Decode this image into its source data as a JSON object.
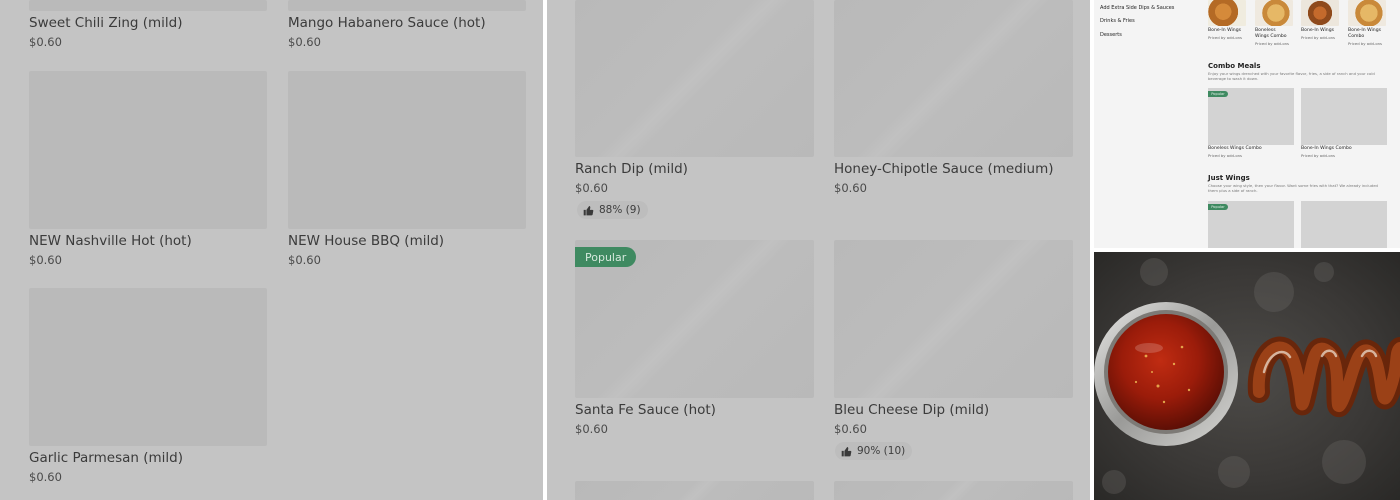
{
  "left_panel": {
    "items": [
      {
        "name": "Sweet Chili Zing (mild)",
        "price": "$0.60"
      },
      {
        "name": "Mango Habanero Sauce (hot)",
        "price": "$0.60"
      },
      {
        "name": "NEW Nashville Hot (hot)",
        "price": "$0.60"
      },
      {
        "name": "NEW House BBQ (mild)",
        "price": "$0.60"
      },
      {
        "name": "Garlic Parmesan (mild)",
        "price": "$0.60"
      }
    ]
  },
  "middle_panel": {
    "items": [
      {
        "name": "Ranch Dip (mild)",
        "price": "$0.60",
        "rating": "88% (9)"
      },
      {
        "name": "Honey-Chipotle Sauce (medium)",
        "price": "$0.60"
      },
      {
        "name": "Santa Fe Sauce (hot)",
        "price": "$0.60",
        "badge": "Popular"
      },
      {
        "name": "Bleu Cheese Dip (mild)",
        "price": "$0.60",
        "rating": "90% (10)"
      }
    ]
  },
  "mini_screenshot": {
    "sidebar": [
      "Add Extra Side Dips & Sauces",
      "Drinks & Fries",
      "Desserts"
    ],
    "top_row": [
      {
        "name": "Bone-In Wings",
        "sub": "Priced by add-ons"
      },
      {
        "name": "Boneless Wings Combo",
        "sub": "Priced by add-ons"
      },
      {
        "name": "Bone-In Wings",
        "sub": "Priced by add-ons"
      },
      {
        "name": "Bone-In Wings Combo",
        "sub": "Priced by add-ons"
      }
    ],
    "combo": {
      "title": "Combo Meals",
      "desc": "Enjoy your wings drenched with your favorite flavor, fries, a side of ranch and your cold beverage to wash it down.",
      "badge": "Popular",
      "items": [
        {
          "name": "Boneless Wings Combo",
          "sub": "Priced by add-ons"
        },
        {
          "name": "Bone-In Wings Combo",
          "sub": "Priced by add-ons"
        }
      ]
    },
    "just_wings": {
      "title": "Just Wings",
      "desc": "Choose your wing style, then your flavor. Want some fries with that? We already included them plus a side of ranch.",
      "badge": "Popular"
    }
  },
  "colors": {
    "panel_bg": "#c4c4c4",
    "popular_green": "#3f8a61"
  }
}
